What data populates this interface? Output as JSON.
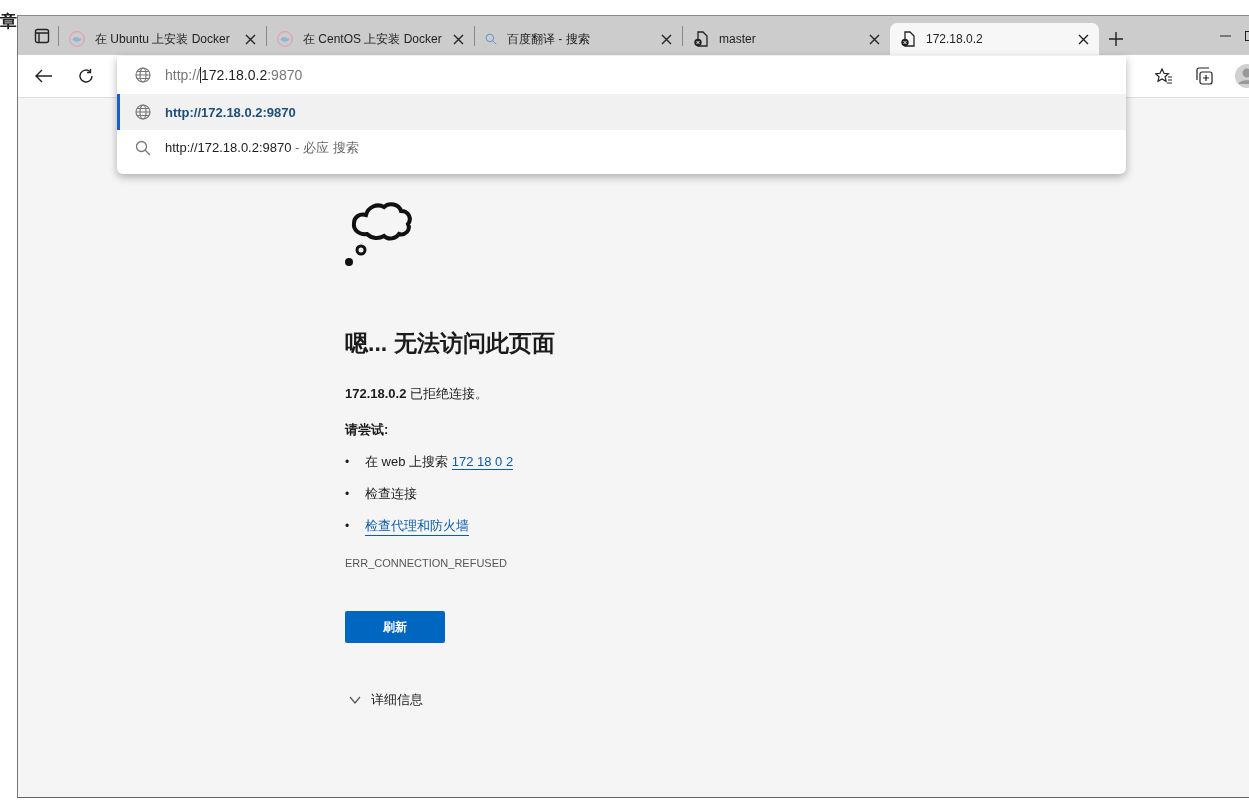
{
  "background_page": {
    "heading_char": "章"
  },
  "tabs": [
    {
      "title": "在 Ubuntu 上安装 Docker",
      "kind": "site",
      "selected": false
    },
    {
      "title": "在 CentOS 上安装 Docker",
      "kind": "site",
      "selected": false
    },
    {
      "title": "百度翻译 - 搜索",
      "kind": "search",
      "selected": false
    },
    {
      "title": "master",
      "kind": "error",
      "selected": false
    },
    {
      "title": "172.18.0.2",
      "kind": "error",
      "selected": true
    }
  ],
  "omnibox": {
    "scheme": "http://",
    "host": "172.18.0.2",
    "port": ":9870"
  },
  "suggestions": [
    {
      "kind": "url",
      "text": "http://172.18.0.2:9870",
      "selected": true
    },
    {
      "kind": "search",
      "text": "http://172.18.0.2:9870",
      "suffix": " - 必应 搜索",
      "selected": false
    }
  ],
  "error_page": {
    "title": "嗯... 无法访问此页面",
    "message_host": "172.18.0.2",
    "message_text": " 已拒绝连接。",
    "try_label": "请尝试:",
    "suggestions": [
      {
        "bullet": "•",
        "text": "在 web 上搜索 ",
        "link": "172 18 0 2"
      },
      {
        "bullet": "•",
        "text": "检查连接"
      },
      {
        "bullet": "•",
        "link": "检查代理和防火墙"
      }
    ],
    "error_code": "ERR_CONNECTION_REFUSED",
    "refresh_button": "刷新",
    "details": {
      "label": "详细信息",
      "expanded": false
    }
  }
}
